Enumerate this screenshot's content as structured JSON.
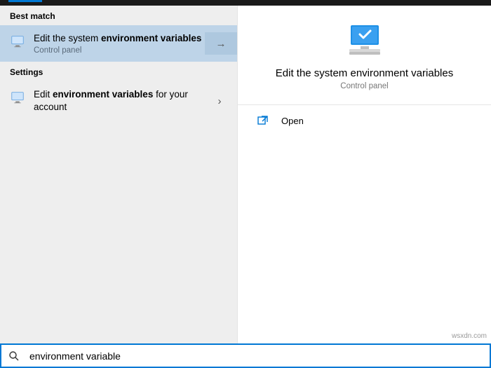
{
  "sections": {
    "best_match": "Best match",
    "settings": "Settings"
  },
  "results": {
    "best": {
      "title_pre": "Edit the system ",
      "title_bold": "environment variables",
      "title_post": "",
      "sub": "Control panel"
    },
    "settings_item": {
      "title_pre": "Edit ",
      "title_bold": "environment variables",
      "title_post": " for your account"
    }
  },
  "detail": {
    "title": "Edit the system environment variables",
    "sub": "Control panel",
    "open": "Open"
  },
  "search": {
    "query": "environment variable"
  },
  "watermark": "wsxdn.com"
}
